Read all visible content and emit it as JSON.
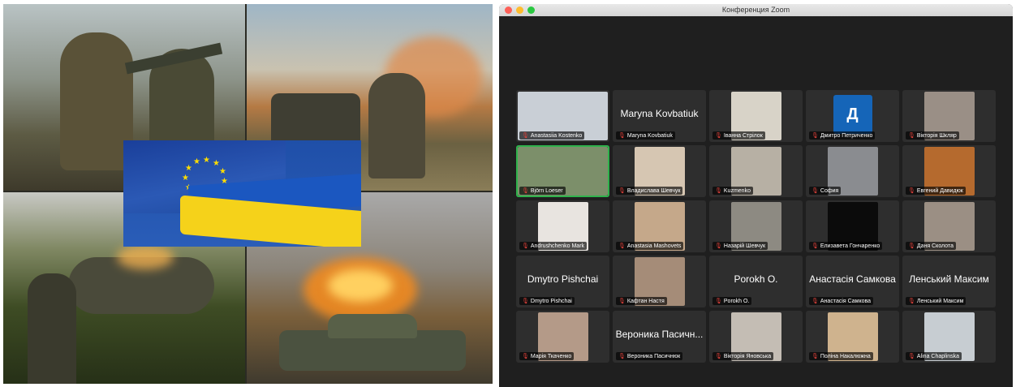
{
  "zoom": {
    "title": "Конференция Zoom",
    "light_colors": [
      "#fd5f57",
      "#febc2e",
      "#29c840"
    ],
    "participants": [
      {
        "name": "Anastasiia Kostenko",
        "video": true,
        "color": "#c9cfd6"
      },
      {
        "name": "Maryna Kovbatiuk",
        "video": false,
        "display": "Maryna Kovbatiuk"
      },
      {
        "name": "Іванна Стрілок",
        "video": true,
        "color": "#d8d3c8"
      },
      {
        "name": "Дмитро Петриченко",
        "video": false,
        "avatar": "Д",
        "avatar_color": "#1565b8"
      },
      {
        "name": "Вікторія Шкляр",
        "video": true,
        "color": "#9a8f86"
      },
      {
        "name": "Björn Loeser",
        "video": true,
        "color": "#7c8f6a",
        "active": true
      },
      {
        "name": "Владислава Шевчук",
        "video": true,
        "color": "#d6c6b2"
      },
      {
        "name": "Kuzmenko",
        "video": true,
        "color": "#b7b0a4"
      },
      {
        "name": "София",
        "video": true,
        "color": "#8a8c90"
      },
      {
        "name": "Евгений Давидюк",
        "video": true,
        "color": "#b56a2e"
      },
      {
        "name": "Andrushchenko Mark",
        "video": true,
        "color": "#e8e4e0"
      },
      {
        "name": "Anastasia Mashovets",
        "video": true,
        "color": "#c5a88a"
      },
      {
        "name": "Назарій Шевчук",
        "video": true,
        "color": "#8d8a82"
      },
      {
        "name": "Елизавета Гончаренко",
        "video": true,
        "color": "#0b0b0b"
      },
      {
        "name": "Даня Сколота",
        "video": true,
        "color": "#9b8f84"
      },
      {
        "name": "Dmytro Pishchai",
        "video": false,
        "display": "Dmytro Pishchai"
      },
      {
        "name": "Кафтан Настя",
        "video": true,
        "color": "#a58c78"
      },
      {
        "name": "Porokh O.",
        "video": false,
        "display": "Porokh O."
      },
      {
        "name": "Анастасія Самкова",
        "video": false,
        "display": "Анастасія Самкова"
      },
      {
        "name": "Ленський Максим",
        "video": false,
        "display": "Ленський Максим"
      },
      {
        "name": "Марія Ткаченко",
        "video": true,
        "color": "#b49a88"
      },
      {
        "name": "Вероника Пасичнюк",
        "video": false,
        "display": "Вероника Пасичн..."
      },
      {
        "name": "Вікторія Яновська",
        "video": true,
        "color": "#c4bdb4"
      },
      {
        "name": "Поліна Накалюжна",
        "video": true,
        "color": "#cfb38e"
      },
      {
        "name": "Alina Chaplinska",
        "video": true,
        "color": "#c7cdd2"
      }
    ]
  }
}
